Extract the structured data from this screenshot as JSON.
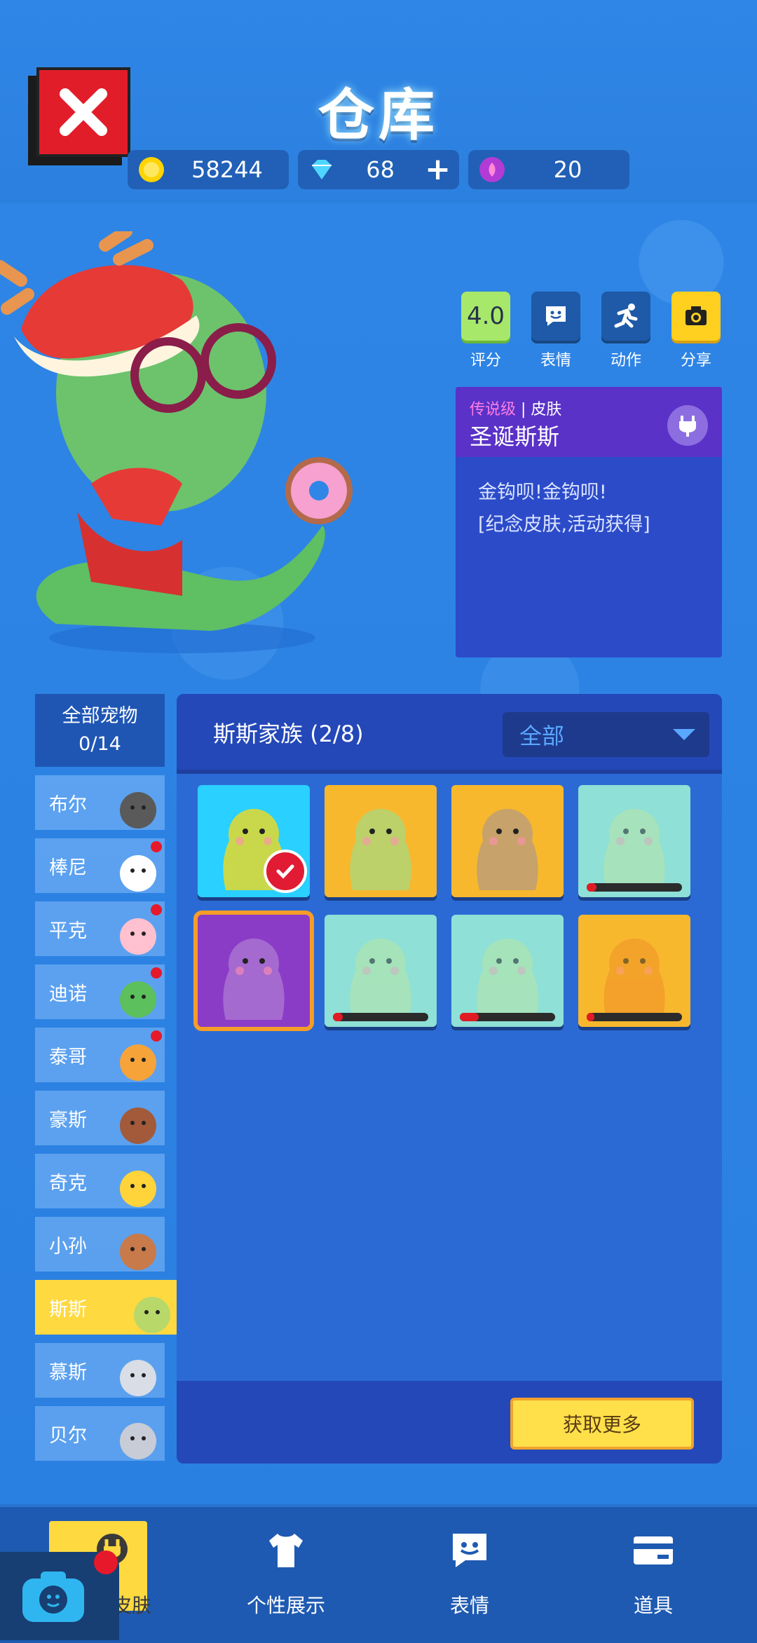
{
  "header": {
    "title": "仓库",
    "close_icon": "close-icon",
    "coins": "58244",
    "diamonds": "68",
    "lotus": "20"
  },
  "actions": [
    {
      "label": "评分",
      "value": "4.0",
      "icon": "rating"
    },
    {
      "label": "表情",
      "icon": "emote-icon"
    },
    {
      "label": "动作",
      "icon": "run-icon"
    },
    {
      "label": "分享",
      "icon": "camera-icon"
    }
  ],
  "skin_card": {
    "rarity": "传说级",
    "type": "皮肤",
    "name": "圣诞斯斯",
    "desc_line1": "金钩呗!金钩呗!",
    "desc_line2": "[纪念皮肤,活动获得]"
  },
  "sidebar": {
    "all_label": "全部宠物",
    "all_count": "0/14",
    "items": [
      {
        "label": "布尔",
        "dot": false
      },
      {
        "label": "棒尼",
        "dot": true
      },
      {
        "label": "平克",
        "dot": true
      },
      {
        "label": "迪诺",
        "dot": true
      },
      {
        "label": "泰哥",
        "dot": true
      },
      {
        "label": "豪斯",
        "dot": false
      },
      {
        "label": "奇克",
        "dot": false
      },
      {
        "label": "小孙",
        "dot": false
      },
      {
        "label": "斯斯",
        "dot": false,
        "active": true
      },
      {
        "label": "慕斯",
        "dot": false
      },
      {
        "label": "贝尔",
        "dot": false
      }
    ]
  },
  "panel": {
    "title": "斯斯家族 (2/8)",
    "filter": "全部",
    "get_more": "获取更多"
  },
  "skins": [
    {
      "owned": true,
      "equipped": true,
      "progress": null
    },
    {
      "owned": true,
      "progress": null
    },
    {
      "owned": true,
      "progress": null
    },
    {
      "owned": false,
      "progress": 0.1
    },
    {
      "owned": true,
      "selected": true,
      "progress": null
    },
    {
      "owned": false,
      "progress": 0.1
    },
    {
      "owned": false,
      "progress": 0.2
    },
    {
      "owned": false,
      "progress": 0.08
    }
  ],
  "nav": {
    "skins": "宠物皮肤",
    "profile": "个性展示",
    "emote": "表情",
    "items": "道具"
  },
  "colors": {
    "accent_yellow": "#ffd940",
    "legendary_purple": "#5a32c7",
    "close_red": "#e21d2a"
  }
}
